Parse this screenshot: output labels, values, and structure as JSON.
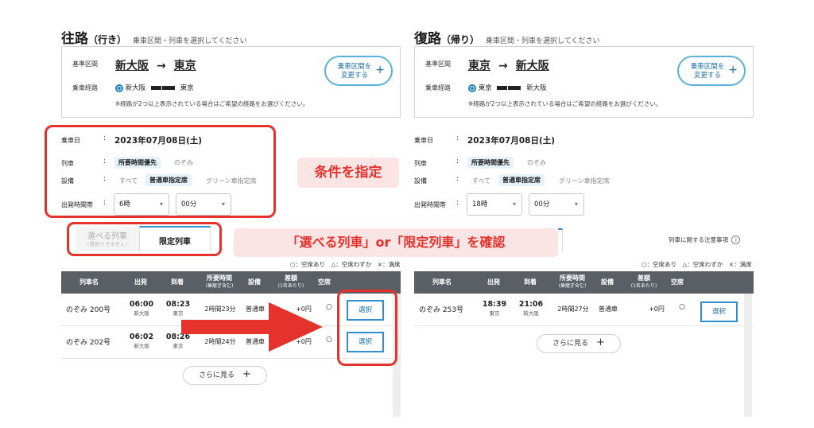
{
  "outbound": {
    "title": "往路",
    "title_paren": "（行き）",
    "hint": "乗車区間・列車を選択してください",
    "base_label": "基準区間",
    "from": "新大阪",
    "to": "東京",
    "arrow": "→",
    "route_label": "乗車経路",
    "path_from": "新大阪",
    "path_to": "東京",
    "route_note": "※経路が2つ以上表示されている場合はご希望の経路をお選びください。",
    "change_button": [
      "乗車区間を",
      "変更する"
    ],
    "date_label": "乗車日",
    "date_value": "2023年07月08日(土)",
    "train_label": "列車",
    "train_options": [
      "所要時間優先",
      "のぞみ"
    ],
    "facility_label": "設備",
    "facility_options": [
      "すべて",
      "普通車指定席",
      "グリーン車指定席"
    ],
    "time_label": "出発時間帯",
    "hour_value": "6時",
    "minute_value": "00分",
    "tabs": {
      "selectable": "選べる列車",
      "selectable_sub": "(選択できません)",
      "limited": "限定列車"
    },
    "legend": "○：空席あり　△：空席わずか　×：満席",
    "headers": [
      "列車名",
      "出発",
      "到着",
      "所要時間",
      "(乗継ぎ含む)",
      "設備",
      "差額",
      "(1名あたり)",
      "空席"
    ],
    "rows": [
      {
        "name": "のぞみ 200号",
        "dep": "06:00",
        "dep_st": "新大阪",
        "arr": "08:23",
        "arr_st": "東京",
        "dur": "2時間23分",
        "fac": "普通車",
        "diff": "+0円",
        "seat": "○",
        "btn": "選択"
      },
      {
        "name": "のぞみ 202号",
        "dep": "06:02",
        "dep_st": "新大阪",
        "arr": "08:26",
        "arr_st": "東京",
        "dur": "2時間24分",
        "fac": "普通車",
        "diff": "+0円",
        "seat": "○",
        "btn": "選択"
      }
    ],
    "more": "さらに見る"
  },
  "return": {
    "title": "復路",
    "title_paren": "（帰り）",
    "hint": "乗車区間・列車を選択してください",
    "base_label": "基準区間",
    "from": "東京",
    "to": "新大阪",
    "arrow": "→",
    "route_label": "乗車経路",
    "path_from": "東京",
    "path_to": "新大阪",
    "route_note": "※経路が2つ以上表示されている場合はご希望の経路をお選びください。",
    "change_button": [
      "乗車区間を",
      "変更する"
    ],
    "date_label": "乗車日",
    "date_value": "2023年07月08日(土)",
    "train_label": "列車",
    "train_options": [
      "所要時間優先",
      "のぞみ"
    ],
    "facility_label": "設備",
    "facility_options": [
      "すべて",
      "普通車指定席",
      "グリーン車指定席"
    ],
    "time_label": "出発時間帯",
    "hour_value": "18時",
    "minute_value": "00分",
    "notice_link": "列車に関する注意事項",
    "legend": "○：空席あり　△：空席わずか　×：満席",
    "headers": [
      "列車名",
      "出発",
      "到着",
      "所要時間",
      "(乗継ぎ含む)",
      "設備",
      "差額",
      "(1名あたり)",
      "空席"
    ],
    "rows": [
      {
        "name": "のぞみ 253号",
        "dep": "18:39",
        "dep_st": "東京",
        "arr": "21:06",
        "arr_st": "新大阪",
        "dur": "2時間27分",
        "fac": "普通車",
        "diff": "+0円",
        "seat": "○",
        "btn": "選択"
      }
    ],
    "more": "さらに見る"
  },
  "annotations": {
    "conditions": "条件を指定",
    "trains": "「選べる列車」or「限定列車」を確認"
  },
  "colors": {
    "accent_red": "#e5322d",
    "callout_bg": "#fbe4e4",
    "header_gray": "#5a5f66",
    "link_blue": "#1b6fa8"
  }
}
